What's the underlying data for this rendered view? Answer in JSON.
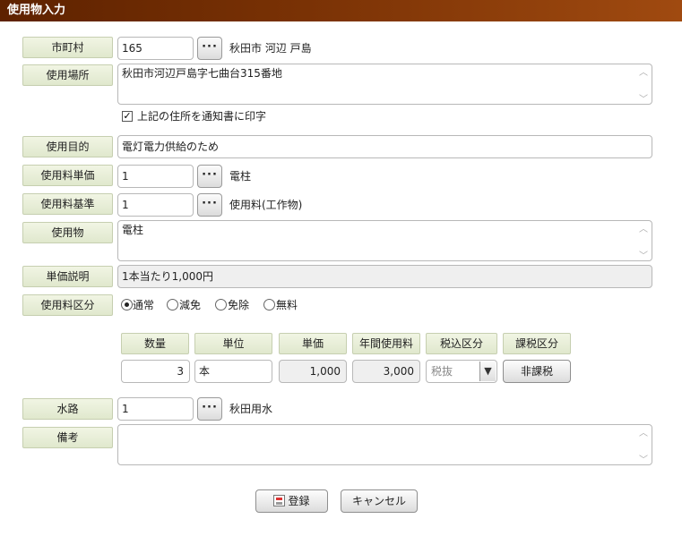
{
  "title": "使用物入力",
  "labels": {
    "municipality": "市町村",
    "location": "使用場所",
    "purpose": "使用目的",
    "unit_price": "使用料単価",
    "fee_basis": "使用料基準",
    "usage_item": "使用物",
    "unit_desc": "単価説明",
    "fee_category": "使用料区分",
    "waterway": "水路",
    "remarks": "備考"
  },
  "municipality": {
    "code": "165",
    "name": "秋田市 河辺 戸島"
  },
  "location": {
    "value": "秋田市河辺戸島字七曲台315番地"
  },
  "print_address": {
    "checked": true,
    "label": "上記の住所を通知書に印字"
  },
  "purpose": {
    "value": "電灯電力供給のため"
  },
  "unit_price": {
    "code": "1",
    "name": "電柱"
  },
  "fee_basis": {
    "code": "1",
    "name": "使用料(工作物)"
  },
  "usage_item": {
    "value": "電柱"
  },
  "unit_desc": {
    "value": "1本当たり1,000円"
  },
  "fee_category": {
    "selected": "通常",
    "options": [
      "通常",
      "減免",
      "免除",
      "無料"
    ]
  },
  "table": {
    "headers": [
      "数量",
      "単位",
      "単価",
      "年間使用料",
      "税込区分",
      "課税区分"
    ],
    "row": {
      "quantity": "3",
      "unit": "本",
      "unit_price": "1,000",
      "annual_fee": "3,000",
      "tax_incl": "税抜",
      "taxable": "非課税"
    }
  },
  "waterway": {
    "code": "1",
    "name": "秋田用水"
  },
  "remarks": {
    "value": ""
  },
  "buttons": {
    "dots": "···",
    "register": "登録",
    "cancel": "キャンセル"
  },
  "icons": {
    "save": "save-icon",
    "dropdown": "chevron-down-icon",
    "scroll_up": "chevron-up-icon",
    "scroll_down": "chevron-down-icon"
  }
}
